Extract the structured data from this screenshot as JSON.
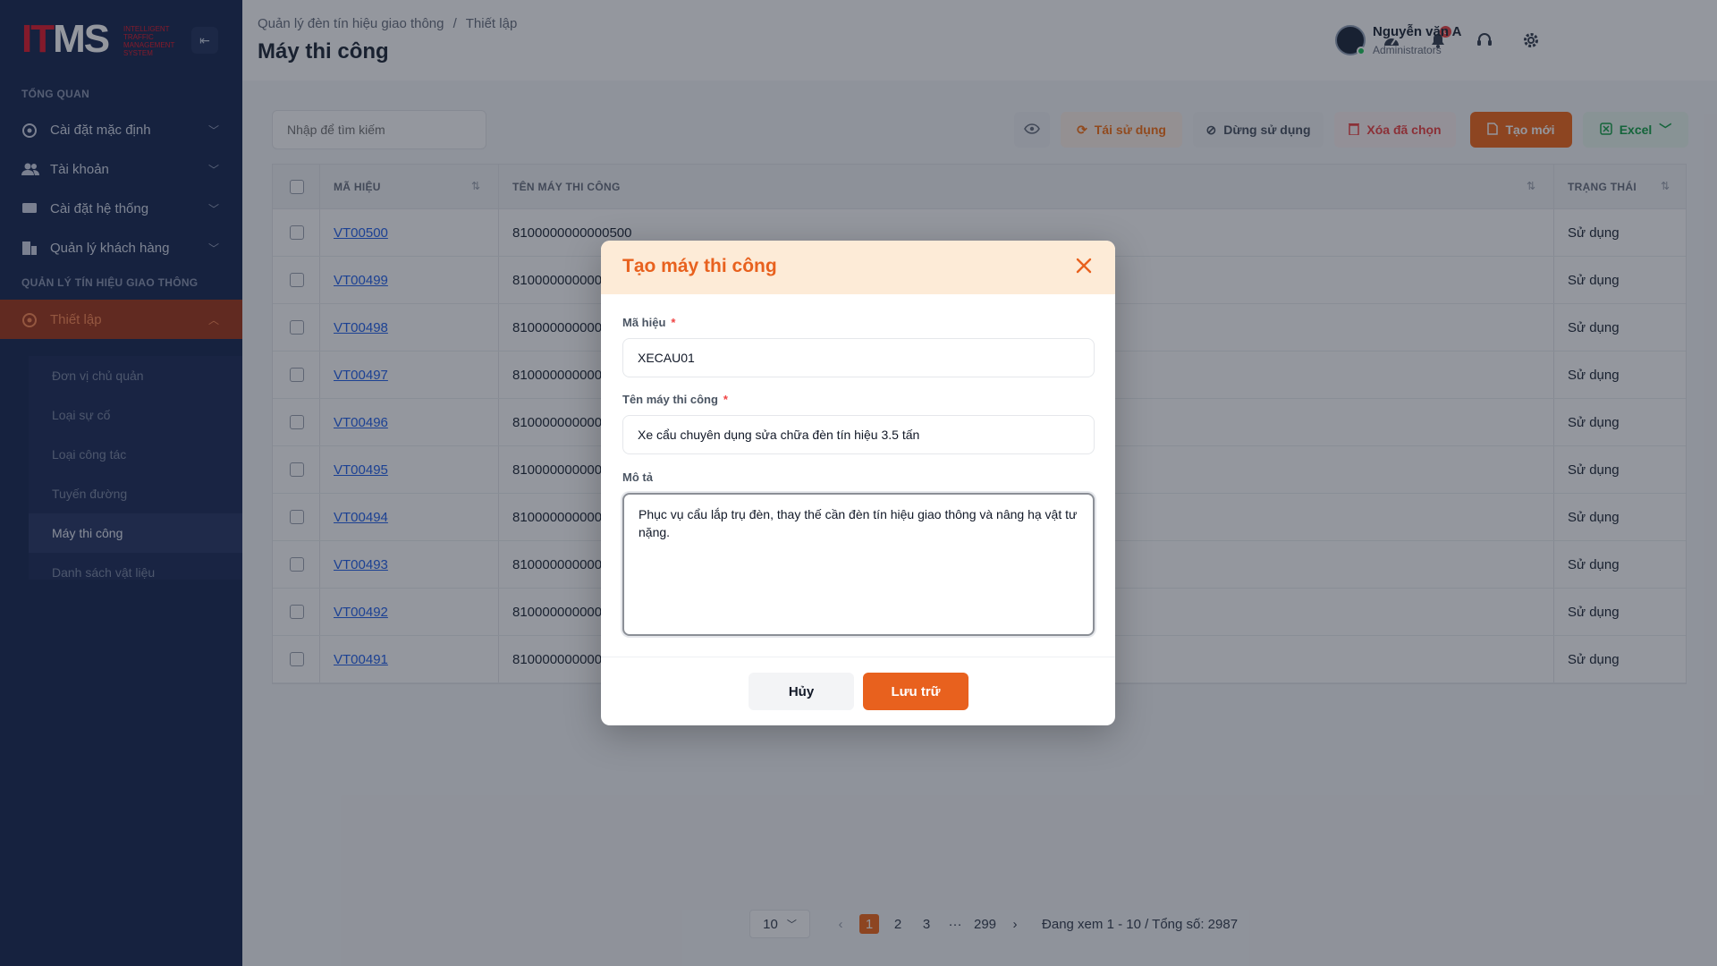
{
  "brand": {
    "logo_text_1": "IT",
    "logo_text_2": "MS",
    "logo_subtitle": "Intelligent Traffic Management System"
  },
  "sidebar": {
    "section_overview": "TỔNG QUAN",
    "section_traffic": "QUẢN LÝ TÍN HIỆU GIAO THÔNG",
    "items": [
      {
        "label": "Cài đặt mặc định"
      },
      {
        "label": "Tài khoản"
      },
      {
        "label": "Cài đặt hệ thống"
      },
      {
        "label": "Quản lý khách hàng"
      },
      {
        "label": "Thiết lập"
      }
    ],
    "sub_items": [
      {
        "label": "Đơn vị chủ quản"
      },
      {
        "label": "Loại sự cố"
      },
      {
        "label": "Loại công tác"
      },
      {
        "label": "Tuyến đường"
      },
      {
        "label": "Máy thi công"
      },
      {
        "label": "Danh sách vật liệu"
      }
    ]
  },
  "header": {
    "breadcrumb_1": "Quản lý đèn tín hiệu giao thông",
    "breadcrumb_sep": "/",
    "breadcrumb_2": "Thiết lập",
    "title": "Máy thi công",
    "notif_count": "0",
    "user_name": "Nguyễn văn A",
    "user_role": "Administrators"
  },
  "toolbar": {
    "search_placeholder": "Nhập để tìm kiếm",
    "reuse_label": "Tái sử dụng",
    "stop_label": "Dừng sử dụng",
    "delete_label": "Xóa đã chọn",
    "new_label": "Tạo mới",
    "excel_label": "Excel"
  },
  "table": {
    "col_code": "MÃ HIỆU",
    "col_name": "TÊN MÁY THI CÔNG",
    "col_status": "TRẠNG THÁI",
    "rows": [
      {
        "code": "VT00500",
        "name": "8100000000000500",
        "status": "Sử dụng"
      },
      {
        "code": "VT00499",
        "name": "8100000000000499",
        "status": "Sử dụng"
      },
      {
        "code": "VT00498",
        "name": "8100000000000498",
        "status": "Sử dụng"
      },
      {
        "code": "VT00497",
        "name": "8100000000000497",
        "status": "Sử dụng"
      },
      {
        "code": "VT00496",
        "name": "8100000000000496",
        "status": "Sử dụng"
      },
      {
        "code": "VT00495",
        "name": "8100000000000495",
        "status": "Sử dụng"
      },
      {
        "code": "VT00494",
        "name": "8100000000000494",
        "status": "Sử dụng"
      },
      {
        "code": "VT00493",
        "name": "8100000000000493",
        "status": "Sử dụng"
      },
      {
        "code": "VT00492",
        "name": "8100000000000492",
        "status": "Sử dụng"
      },
      {
        "code": "VT00491",
        "name": "8100000000000491",
        "status": "Sử dụng"
      }
    ]
  },
  "pagination": {
    "page_size": "10",
    "pages": [
      "1",
      "2",
      "3",
      "···",
      "299"
    ],
    "active_page": "1",
    "info": "Đang xem 1 - 10 / Tổng số: 2987"
  },
  "modal": {
    "title": "Tạo máy thi công",
    "code_label": "Mã hiệu",
    "code_value": "XECAU01",
    "name_label": "Tên máy thi công",
    "name_value": "Xe cẩu chuyên dụng sửa chữa đèn tín hiệu 3.5 tấn",
    "desc_label": "Mô tả",
    "desc_value": "Phục vụ cẩu lắp trụ đèn, thay thế cần đèn tín hiệu giao thông và nâng hạ vật tư nặng.",
    "required_mark": "*",
    "cancel_label": "Hủy",
    "save_label": "Lưu trữ"
  },
  "colors": {
    "accent": "#e8611e",
    "sidebar_bg": "#1b2a52",
    "link": "#2563eb"
  }
}
